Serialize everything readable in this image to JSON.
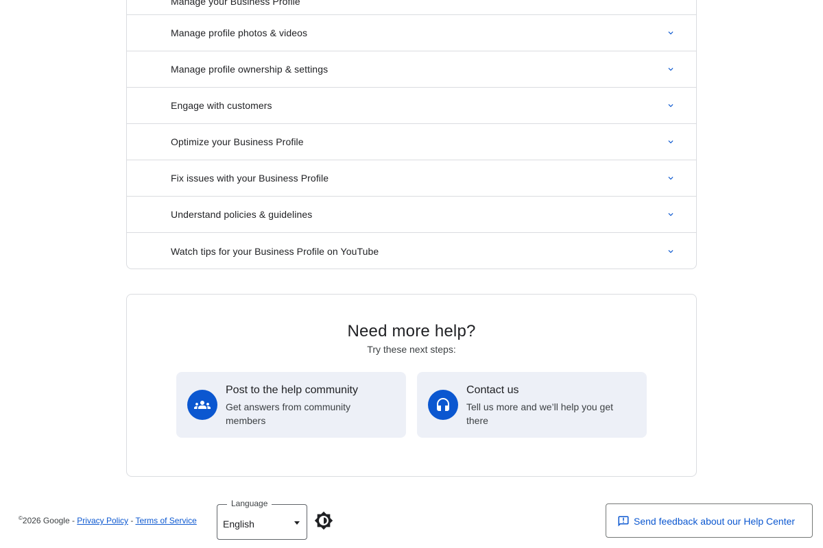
{
  "accordion": {
    "items": [
      {
        "label": "Manage your Business Profile"
      },
      {
        "label": "Manage profile photos & videos"
      },
      {
        "label": "Manage profile ownership & settings"
      },
      {
        "label": "Engage with customers"
      },
      {
        "label": "Optimize your Business Profile"
      },
      {
        "label": "Fix issues with your Business Profile"
      },
      {
        "label": "Understand policies & guidelines"
      },
      {
        "label": "Watch tips for your Business Profile on YouTube"
      }
    ]
  },
  "help": {
    "title": "Need more help?",
    "subtitle": "Try these next steps:",
    "options": [
      {
        "title": "Post to the help community",
        "description": "Get answers from community members",
        "icon": "community-icon"
      },
      {
        "title": "Contact us",
        "description": "Tell us more and we’ll help you get there",
        "icon": "headset-icon"
      }
    ]
  },
  "footer": {
    "copyright_symbol": "©",
    "copyright": "2026 Google - ",
    "privacy": "Privacy Policy",
    "separator": " - ",
    "terms": "Terms of Service",
    "language_label": "Language",
    "language_value": "English",
    "theme_icon": "brightness-icon",
    "feedback_label": "Send feedback about our Help Center",
    "feedback_icon": "feedback-icon"
  },
  "colors": {
    "accent": "#0b57d0",
    "card_bg": "#edf0f7",
    "border": "#dadce0"
  }
}
